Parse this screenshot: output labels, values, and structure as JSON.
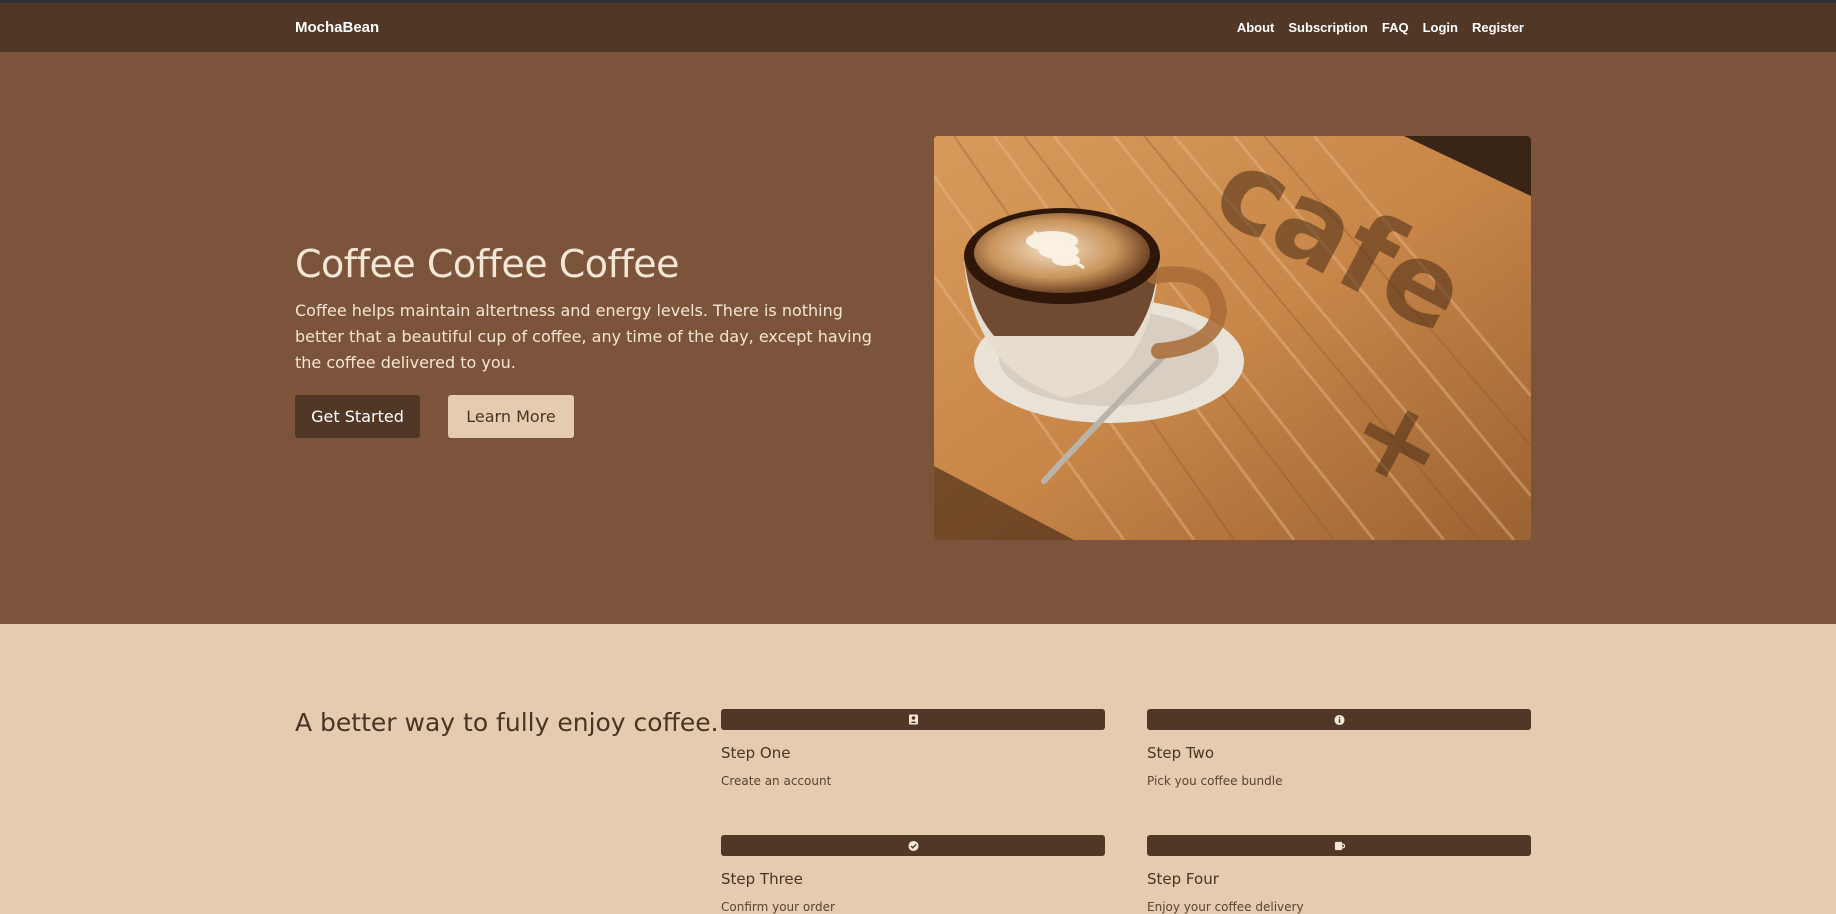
{
  "nav": {
    "brand": "MochaBean",
    "links": [
      "About",
      "Subscription",
      "FAQ",
      "Login",
      "Register"
    ]
  },
  "hero": {
    "title": "Coffee Coffee Coffee",
    "text": "Coffee helps maintain altertness and energy levels. There is nothing better that a beautiful cup of coffee, any time of the day, except having the coffee delivered to you.",
    "primary_button": "Get Started",
    "secondary_button": "Learn More",
    "image_icon": "latte-cup-photo"
  },
  "features": {
    "title": "A better way to fully enjoy coffee.",
    "steps": [
      {
        "title": "Step One",
        "desc": "Create an account",
        "icon": "account-icon"
      },
      {
        "title": "Step Two",
        "desc": "Pick you coffee bundle",
        "icon": "info-icon"
      },
      {
        "title": "Step Three",
        "desc": "Confirm your order",
        "icon": "check-icon"
      },
      {
        "title": "Step Four",
        "desc": "Enjoy your coffee delivery",
        "icon": "mug-icon"
      }
    ]
  },
  "colors": {
    "navbar": "#513726",
    "hero_bg": "#7b543b",
    "features_bg": "#e5cbb0",
    "accent_dark": "#513726"
  }
}
